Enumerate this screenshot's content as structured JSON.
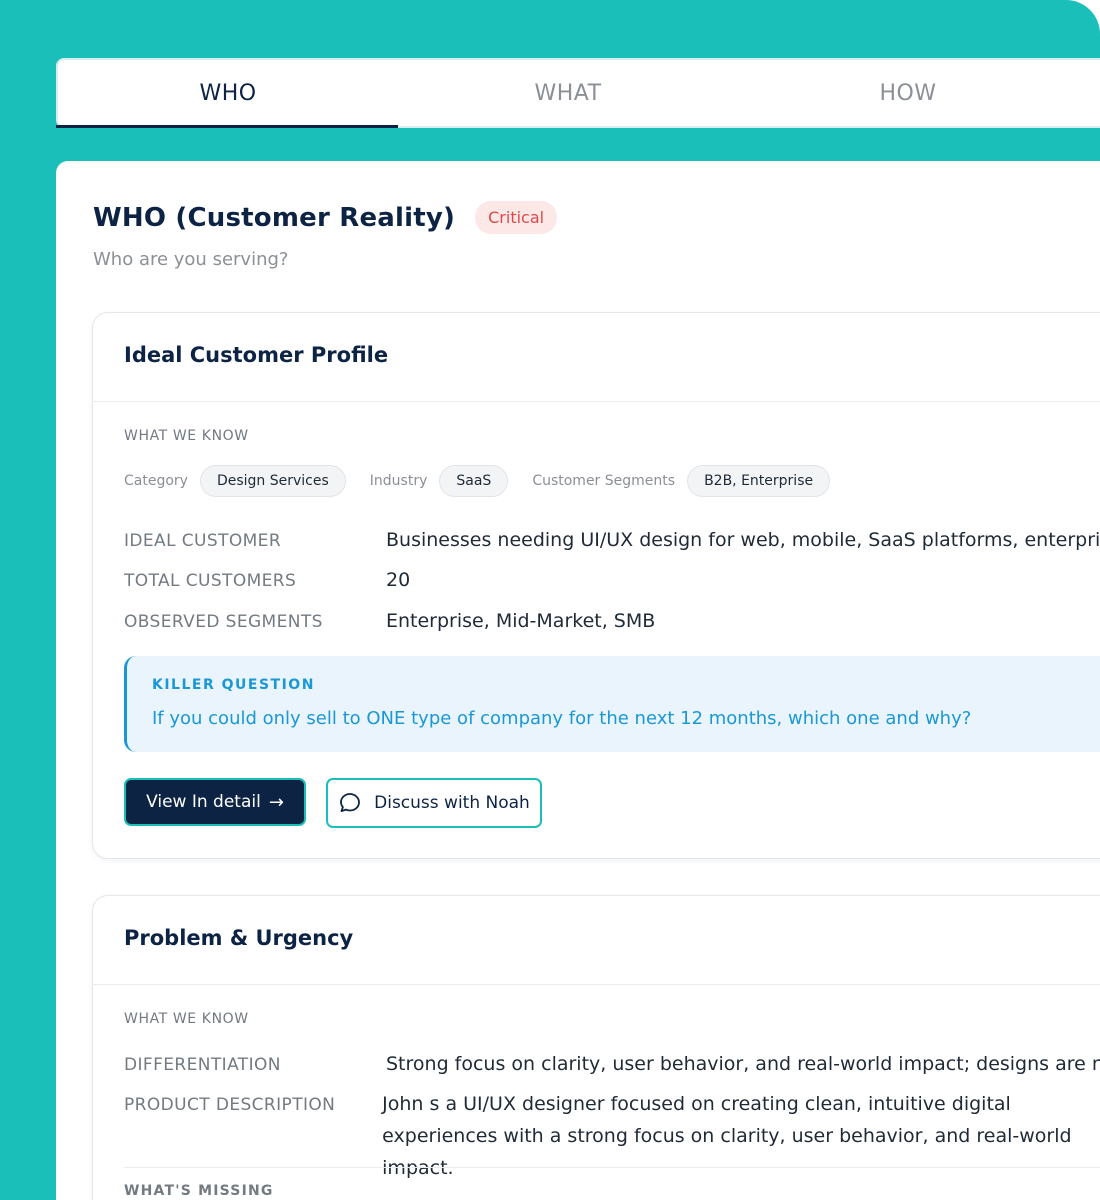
{
  "tabs": [
    {
      "label": "WHO",
      "active": true
    },
    {
      "label": "WHAT",
      "active": false
    },
    {
      "label": "HOW",
      "active": false
    }
  ],
  "header": {
    "title": "WHO (Customer Reality)",
    "badge": "Critical",
    "subtitle": "Who are you serving?"
  },
  "icp_card": {
    "title": "Ideal Customer Profile",
    "section_label": "WHAT WE KNOW",
    "chips": [
      {
        "label": "Category",
        "value": "Design Services"
      },
      {
        "label": "Industry",
        "value": "SaaS"
      },
      {
        "label": "Customer Segments",
        "value": "B2B, Enterprise"
      }
    ],
    "rows": [
      {
        "key": "IDEAL CUSTOMER",
        "value": "Businesses needing UI/UX design for web, mobile, SaaS platforms, enterprise"
      },
      {
        "key": "TOTAL CUSTOMERS",
        "value": "20"
      },
      {
        "key": "OBSERVED SEGMENTS",
        "value": "Enterprise, Mid-Market, SMB"
      }
    ],
    "killer_question": {
      "label": "KILLER QUESTION",
      "text": "If you could only sell to ONE type of company for the next 12 months, which one and why?"
    },
    "view_button": "View In detail",
    "discuss_button": "Discuss with Noah"
  },
  "problem_card": {
    "title": "Problem & Urgency",
    "section_label": "WHAT WE KNOW",
    "rows": [
      {
        "key": "DIFFERENTIATION",
        "value": "Strong focus on clarity, user behavior, and real-world impact; designs are not"
      },
      {
        "key": "PRODUCT DESCRIPTION",
        "value": "John s a UI/UX designer focused on creating clean, intuitive digital experiences with a strong focus on clarity, user behavior, and real-world impact."
      }
    ],
    "missing_label": "WHAT'S MISSING"
  },
  "colors": {
    "frame": "#1bbfba",
    "navy": "#0d2344",
    "critical": "#e04848",
    "killer_blue": "#1a98d6"
  }
}
